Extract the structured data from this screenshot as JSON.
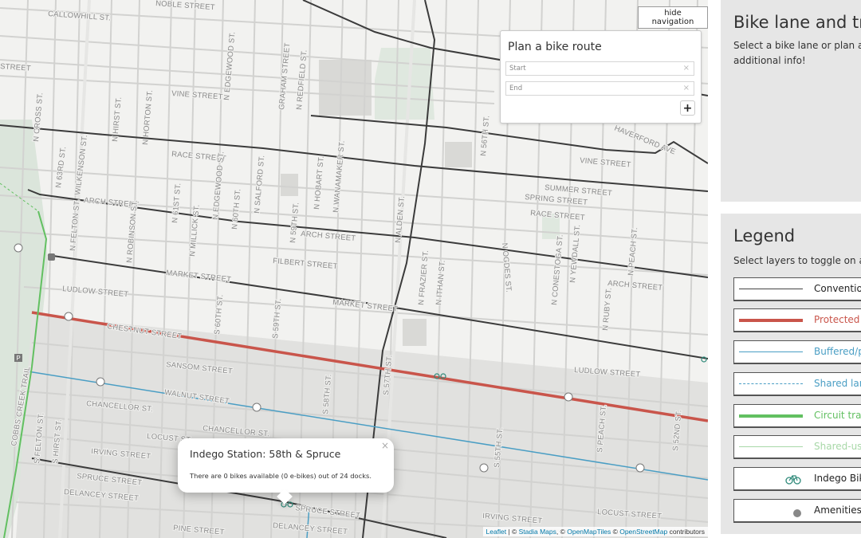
{
  "map": {
    "hide_navigation_label": "hide navigation",
    "route_planner": {
      "title": "Plan a bike route",
      "start_placeholder": "Start",
      "end_placeholder": "End",
      "clear_icon": "×",
      "add_button": "+"
    },
    "popup": {
      "title": "Indego Station: 58th & Spruce",
      "body": "There are 0 bikes available (0 e-bikes) out of 24 docks.",
      "close": "×"
    },
    "attribution": {
      "leaflet": "Leaflet",
      "sep1": " | © ",
      "stadia": "Stadia Maps",
      "sep2": ", © ",
      "openmaptiles": "OpenMapTiles",
      "sep3": " © ",
      "osm": "OpenStreetMap",
      "suffix": " contributors"
    },
    "street_labels": {
      "noble": "NOBLE STREET",
      "callowhill": "CALLOWHILL ST.",
      "street_w": "STREET",
      "vine": "VINE STREET",
      "vine_e": "VINE STREET",
      "race": "RACE STREET",
      "race_e": "RACE STREET",
      "summer": "SUMMER STREET",
      "spring": "SPRING STREET",
      "arch_w": "ARCH STREET",
      "arch": "ARCH STREET",
      "arch_e": "ARCH STREET",
      "filbert": "FILBERT STREET",
      "market": "MARKET STREET",
      "market_e": "MARKET STREET",
      "ludlow_w": "LUDLOW STREET",
      "ludlow_e": "LUDLOW STREET",
      "chestnut": "CHESTNUT STREET",
      "sansom": "SANSOM STREET",
      "walnut": "WALNUT STREET",
      "chancellor_w": "CHANCELLOR ST.",
      "chancellor": "CHANCELLOR ST.",
      "locust_w": "LOCUST ST.",
      "locust_e": "LOCUST STREET",
      "irving_w": "IRVING STREET",
      "irving_e": "IRVING STREET",
      "spruce_w": "SPRUCE STREET",
      "spruce_e": "SPRUCE STREET",
      "delancey_w": "DELANCEY STREET",
      "delancey_e": "DELANCEY STREET",
      "pine": "PINE STREET",
      "haverford": "HAVERFORD AVE",
      "n_cross": "N CROSS ST.",
      "n_63rd": "N 63RD ST.",
      "wilkenson": "WILKENSON ST.",
      "n_felton": "N FELTON ST.",
      "n_robinson": "N ROBINSON ST.",
      "n_hirst": "N HIRST ST.",
      "n_horton": "N HORTON ST.",
      "n_61st": "N 61ST ST.",
      "n_millick": "N MILLICK ST.",
      "n_edgewood": "N EDGEWOOD ST.",
      "n_edgewood_n": "N EDGEWOOD ST.",
      "n_60th": "N 60TH ST.",
      "n_salford": "N SALFORD ST.",
      "n_59th": "N 59TH ST.",
      "n_hobart": "N HOBART ST.",
      "n_wanamaker": "N WANAMAKER ST.",
      "graham": "GRAHAM STREET",
      "n_redfield": "N REDFIELD ST.",
      "n_alden": "N ALDEN ST.",
      "n_56th": "N 56TH ST.",
      "n_ogdes": "N OGDES ST.",
      "n_frazier": "N FRAZIER ST.",
      "n_ithan": "N ITHAN ST.",
      "n_conestoga": "N CONESTOGA ST.",
      "n_yewdall": "N YEWDALL ST.",
      "n_ruby": "N RUBY ST.",
      "n_peach": "N PEACH ST.",
      "s_felton": "S FELTON ST.",
      "s_hirst": "S HIRST ST.",
      "s_60th": "S 60TH ST.",
      "s_59th": "S 59TH ST.",
      "s_58th": "S 58TH ST.",
      "s_57th": "S 57TH ST.",
      "s_55th": "S 55TH ST.",
      "s_peach": "S PEACH ST.",
      "s_52nd": "S 52ND ST.",
      "cobbs_creek": "COBBS CREEK TRAIL"
    }
  },
  "info_panel": {
    "title": "Bike lane and tr",
    "text_line1": "Select a bike lane or plan a",
    "text_line2": "additional info!"
  },
  "legend": {
    "title": "Legend",
    "subtitle": "Select layers to toggle on ar",
    "items": [
      {
        "label": "Conventio",
        "color": "#444444",
        "style": "thin-solid"
      },
      {
        "label": "Protected",
        "color": "#c9554b",
        "style": "thick-solid"
      },
      {
        "label": "Buffered/p",
        "color": "#4a9ec4",
        "style": "thin-solid"
      },
      {
        "label": "Shared lan",
        "color": "#4a9ec4",
        "style": "dashed"
      },
      {
        "label": "Circuit tra",
        "color": "#62c061",
        "style": "thick-solid"
      },
      {
        "label": "Shared-us",
        "color": "#a8d8a8",
        "style": "thin-solid"
      },
      {
        "label": "Indego Bik",
        "color": "#2f8a7a",
        "style": "bike-icon"
      },
      {
        "label": "Amenities",
        "color": "#888888",
        "style": "dot"
      }
    ]
  }
}
